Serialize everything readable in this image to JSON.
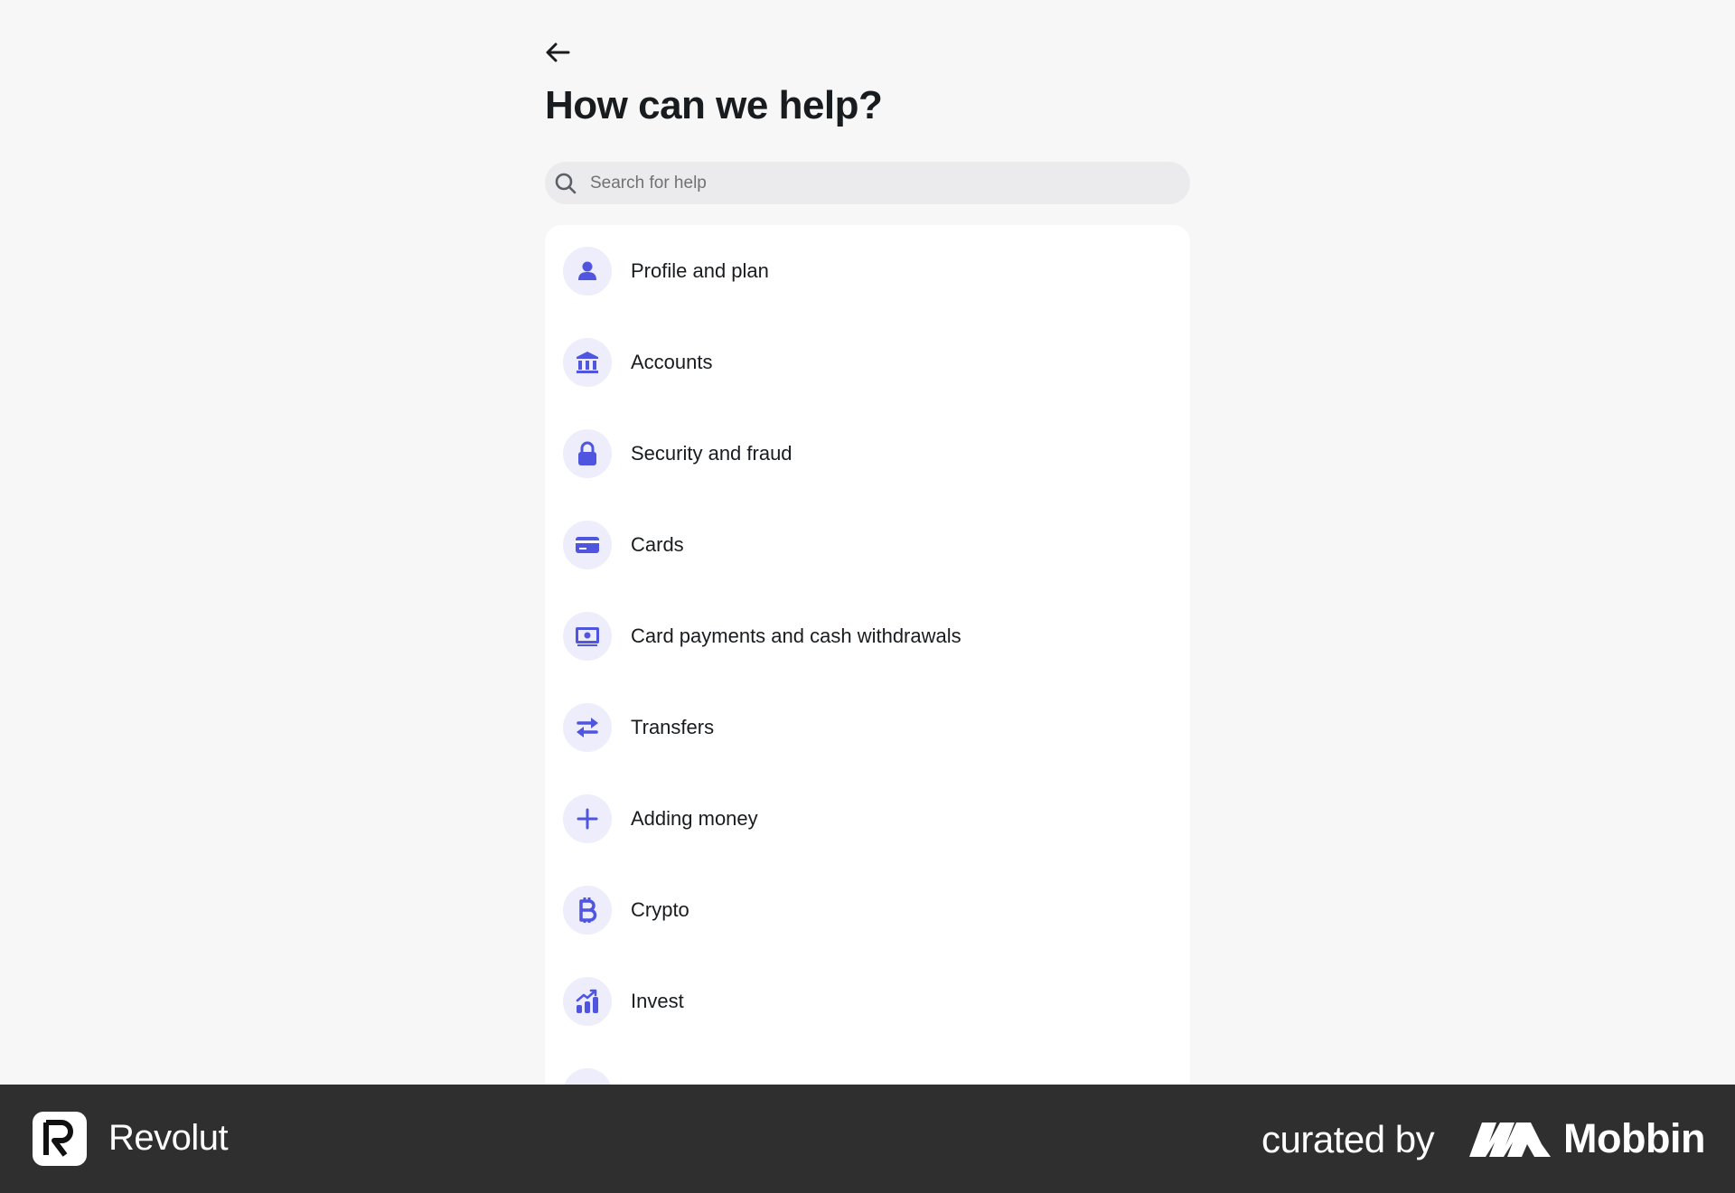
{
  "header": {
    "back_icon": "arrow-left-icon",
    "title": "How can we help?"
  },
  "search": {
    "placeholder": "Search for help",
    "icon": "search-icon"
  },
  "accent_color": "#5055e0",
  "icon_bg_color": "#ededfb",
  "help_topics": [
    {
      "label": "Profile and plan",
      "icon": "person-icon"
    },
    {
      "label": "Accounts",
      "icon": "bank-icon"
    },
    {
      "label": "Security and fraud",
      "icon": "lock-icon"
    },
    {
      "label": "Cards",
      "icon": "credit-card-icon"
    },
    {
      "label": "Card payments and cash withdrawals",
      "icon": "cash-icon"
    },
    {
      "label": "Transfers",
      "icon": "transfer-arrows-icon"
    },
    {
      "label": "Adding money",
      "icon": "plus-icon"
    },
    {
      "label": "Crypto",
      "icon": "bitcoin-icon"
    },
    {
      "label": "Invest",
      "icon": "invest-chart-icon"
    },
    {
      "label": "",
      "icon": "partially-visible-icon"
    }
  ],
  "footer": {
    "brand": "Revolut",
    "curated_by": "curated by",
    "curator": "Mobbin",
    "background": "#2f2f2f"
  }
}
